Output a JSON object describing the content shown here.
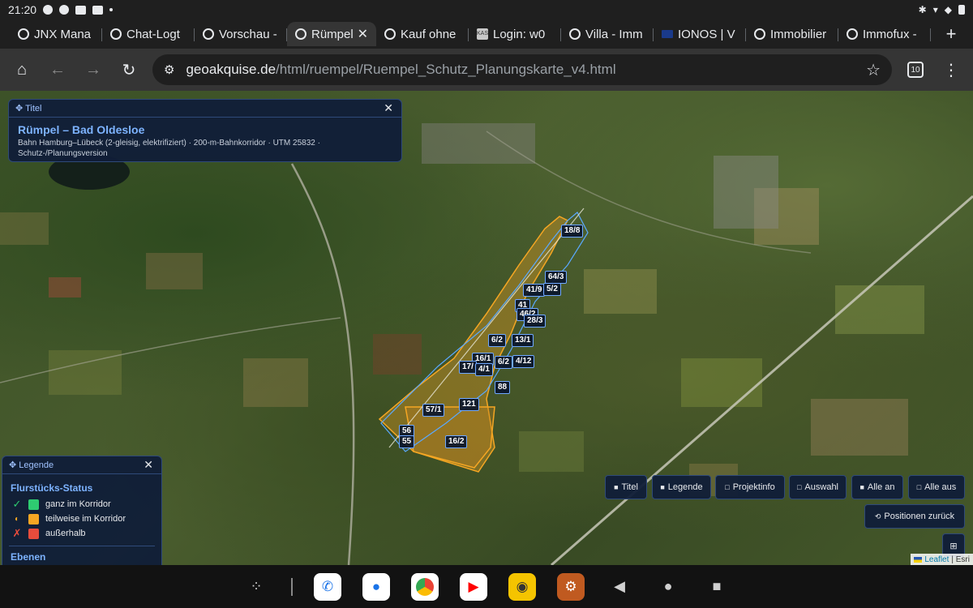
{
  "status_bar": {
    "time": "21:20"
  },
  "tabs": [
    {
      "label": "JNX Mana",
      "icon": "globe-icon"
    },
    {
      "label": "Chat-Logt",
      "icon": "globe-icon"
    },
    {
      "label": "Vorschau -",
      "icon": "globe-icon"
    },
    {
      "label": "Rümpel",
      "icon": "globe-icon",
      "active": true
    },
    {
      "label": "Kauf ohne",
      "icon": "globe-icon"
    },
    {
      "label": "Login: w0",
      "icon": "kas-icon",
      "badge": "KAS"
    },
    {
      "label": "Villa - Imm",
      "icon": "globe-icon"
    },
    {
      "label": "IONOS | V",
      "icon": "ionos-icon"
    },
    {
      "label": "Immobilier",
      "icon": "globe-icon"
    },
    {
      "label": "Immofux -",
      "icon": "globe-icon"
    }
  ],
  "toolbar": {
    "url_host": "geoakquise.de",
    "url_path": "/html/ruempel/Ruempel_Schutz_Planungskarte_v4.html",
    "tab_count": "10"
  },
  "title_panel": {
    "header": "✥ Titel",
    "title": "Rümpel – Bad Oldesloe",
    "subtitle": "Bahn Hamburg–Lübeck (2-gleisig, elektrifiziert) · 200-m-Bahnkorridor · UTM 25832 · Schutz-/Planungsversion"
  },
  "legend": {
    "header": "✥ Legende",
    "section_status": "Flurstücks-Status",
    "items": [
      {
        "mark": "✓",
        "label": "ganz im Korridor",
        "color": "#2ecc71",
        "mark_color": "#2ecc71"
      },
      {
        "mark": "◐",
        "label": "teilweise im Korridor",
        "color": "#f5a623",
        "mark_color": "#f5a623"
      },
      {
        "mark": "✗",
        "label": "außerhalb",
        "color": "#e74c3c",
        "mark_color": "#e74c3c"
      }
    ],
    "section_layers": "Ebenen"
  },
  "map_buttons": {
    "titel": "Titel",
    "legende": "Legende",
    "projektinfo": "Projektinfo",
    "auswahl": "Auswahl",
    "alle_an": "Alle an",
    "alle_aus": "Alle aus",
    "positionen": "Positionen zurück"
  },
  "parcel_labels": [
    "18/8",
    "64/3",
    "41/9",
    "5/2",
    "41",
    "46/2",
    "28/3",
    "6/2",
    "13/1",
    "16/1",
    "6/2",
    "4/12",
    "17/",
    "4/1",
    "88",
    "121",
    "57/1",
    "56",
    "55",
    "16/2"
  ],
  "attribution": {
    "leaflet": "Leaflet",
    "source": "| Esri"
  },
  "colors": {
    "accent": "#7db3ff",
    "partial": "#f5a623",
    "panel": "#101d38"
  }
}
